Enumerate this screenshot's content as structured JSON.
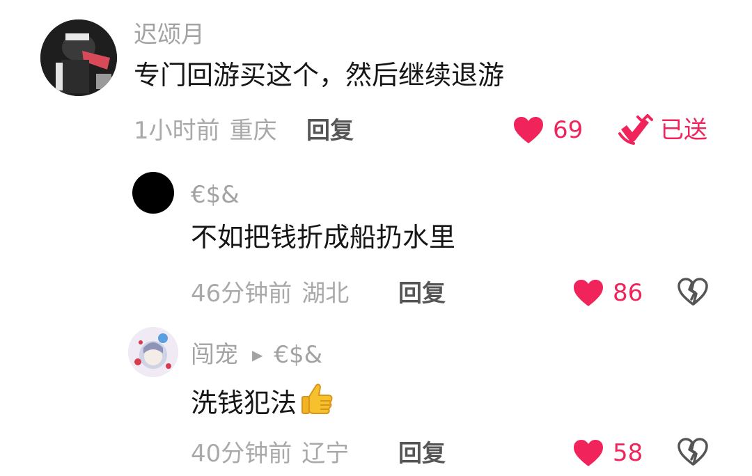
{
  "comments": [
    {
      "username": "迟颂月",
      "text": "专门回游买这个，然后继续退游",
      "time": "1小时前",
      "location": "重庆",
      "reply_label": "回复",
      "likes": "69",
      "sent_label": "已送"
    },
    {
      "username": "€$&",
      "text": "不如把钱折成船扔水里",
      "time": "46分钟前",
      "location": "湖北",
      "reply_label": "回复",
      "likes": "86"
    },
    {
      "username": "闯宠",
      "reply_to": "€$&",
      "text": "洗钱犯法",
      "emoji": "thumbs-up-icon",
      "time": "40分钟前",
      "location": "辽宁",
      "reply_label": "回复",
      "likes": "58"
    }
  ],
  "colors": {
    "accent": "#f0245a",
    "meta_text": "#a9a9a9",
    "body_text": "#161616"
  }
}
